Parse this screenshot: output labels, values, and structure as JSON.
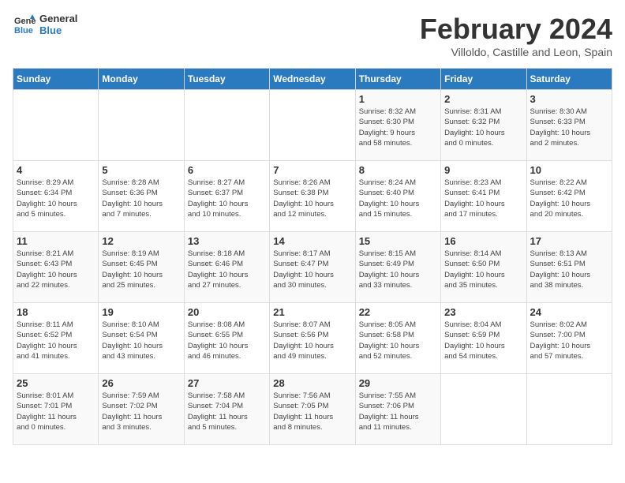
{
  "header": {
    "logo_line1": "General",
    "logo_line2": "Blue",
    "main_title": "February 2024",
    "subtitle": "Villoldo, Castille and Leon, Spain"
  },
  "days_of_week": [
    "Sunday",
    "Monday",
    "Tuesday",
    "Wednesday",
    "Thursday",
    "Friday",
    "Saturday"
  ],
  "weeks": [
    [
      {
        "day": "",
        "info": ""
      },
      {
        "day": "",
        "info": ""
      },
      {
        "day": "",
        "info": ""
      },
      {
        "day": "",
        "info": ""
      },
      {
        "day": "1",
        "info": "Sunrise: 8:32 AM\nSunset: 6:30 PM\nDaylight: 9 hours\nand 58 minutes."
      },
      {
        "day": "2",
        "info": "Sunrise: 8:31 AM\nSunset: 6:32 PM\nDaylight: 10 hours\nand 0 minutes."
      },
      {
        "day": "3",
        "info": "Sunrise: 8:30 AM\nSunset: 6:33 PM\nDaylight: 10 hours\nand 2 minutes."
      }
    ],
    [
      {
        "day": "4",
        "info": "Sunrise: 8:29 AM\nSunset: 6:34 PM\nDaylight: 10 hours\nand 5 minutes."
      },
      {
        "day": "5",
        "info": "Sunrise: 8:28 AM\nSunset: 6:36 PM\nDaylight: 10 hours\nand 7 minutes."
      },
      {
        "day": "6",
        "info": "Sunrise: 8:27 AM\nSunset: 6:37 PM\nDaylight: 10 hours\nand 10 minutes."
      },
      {
        "day": "7",
        "info": "Sunrise: 8:26 AM\nSunset: 6:38 PM\nDaylight: 10 hours\nand 12 minutes."
      },
      {
        "day": "8",
        "info": "Sunrise: 8:24 AM\nSunset: 6:40 PM\nDaylight: 10 hours\nand 15 minutes."
      },
      {
        "day": "9",
        "info": "Sunrise: 8:23 AM\nSunset: 6:41 PM\nDaylight: 10 hours\nand 17 minutes."
      },
      {
        "day": "10",
        "info": "Sunrise: 8:22 AM\nSunset: 6:42 PM\nDaylight: 10 hours\nand 20 minutes."
      }
    ],
    [
      {
        "day": "11",
        "info": "Sunrise: 8:21 AM\nSunset: 6:43 PM\nDaylight: 10 hours\nand 22 minutes."
      },
      {
        "day": "12",
        "info": "Sunrise: 8:19 AM\nSunset: 6:45 PM\nDaylight: 10 hours\nand 25 minutes."
      },
      {
        "day": "13",
        "info": "Sunrise: 8:18 AM\nSunset: 6:46 PM\nDaylight: 10 hours\nand 27 minutes."
      },
      {
        "day": "14",
        "info": "Sunrise: 8:17 AM\nSunset: 6:47 PM\nDaylight: 10 hours\nand 30 minutes."
      },
      {
        "day": "15",
        "info": "Sunrise: 8:15 AM\nSunset: 6:49 PM\nDaylight: 10 hours\nand 33 minutes."
      },
      {
        "day": "16",
        "info": "Sunrise: 8:14 AM\nSunset: 6:50 PM\nDaylight: 10 hours\nand 35 minutes."
      },
      {
        "day": "17",
        "info": "Sunrise: 8:13 AM\nSunset: 6:51 PM\nDaylight: 10 hours\nand 38 minutes."
      }
    ],
    [
      {
        "day": "18",
        "info": "Sunrise: 8:11 AM\nSunset: 6:52 PM\nDaylight: 10 hours\nand 41 minutes."
      },
      {
        "day": "19",
        "info": "Sunrise: 8:10 AM\nSunset: 6:54 PM\nDaylight: 10 hours\nand 43 minutes."
      },
      {
        "day": "20",
        "info": "Sunrise: 8:08 AM\nSunset: 6:55 PM\nDaylight: 10 hours\nand 46 minutes."
      },
      {
        "day": "21",
        "info": "Sunrise: 8:07 AM\nSunset: 6:56 PM\nDaylight: 10 hours\nand 49 minutes."
      },
      {
        "day": "22",
        "info": "Sunrise: 8:05 AM\nSunset: 6:58 PM\nDaylight: 10 hours\nand 52 minutes."
      },
      {
        "day": "23",
        "info": "Sunrise: 8:04 AM\nSunset: 6:59 PM\nDaylight: 10 hours\nand 54 minutes."
      },
      {
        "day": "24",
        "info": "Sunrise: 8:02 AM\nSunset: 7:00 PM\nDaylight: 10 hours\nand 57 minutes."
      }
    ],
    [
      {
        "day": "25",
        "info": "Sunrise: 8:01 AM\nSunset: 7:01 PM\nDaylight: 11 hours\nand 0 minutes."
      },
      {
        "day": "26",
        "info": "Sunrise: 7:59 AM\nSunset: 7:02 PM\nDaylight: 11 hours\nand 3 minutes."
      },
      {
        "day": "27",
        "info": "Sunrise: 7:58 AM\nSunset: 7:04 PM\nDaylight: 11 hours\nand 5 minutes."
      },
      {
        "day": "28",
        "info": "Sunrise: 7:56 AM\nSunset: 7:05 PM\nDaylight: 11 hours\nand 8 minutes."
      },
      {
        "day": "29",
        "info": "Sunrise: 7:55 AM\nSunset: 7:06 PM\nDaylight: 11 hours\nand 11 minutes."
      },
      {
        "day": "",
        "info": ""
      },
      {
        "day": "",
        "info": ""
      }
    ]
  ]
}
